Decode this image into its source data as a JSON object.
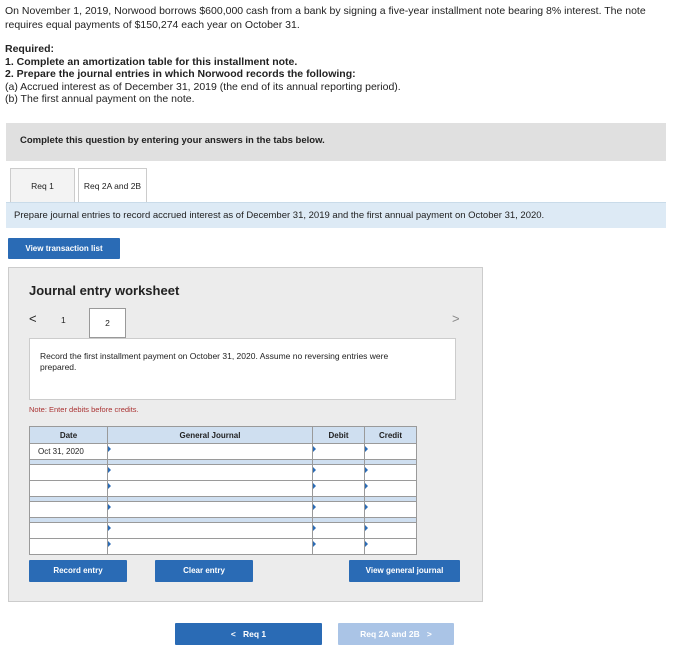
{
  "problem_text": "On November 1, 2019, Norwood borrows $600,000 cash from a bank by signing a five-year installment note bearing 8% interest. The note requires equal payments of $150,274 each year on October 31.",
  "required": {
    "heading": "Required:",
    "item1": "1. Complete an amortization table for this installment note.",
    "item2": "2. Prepare the journal entries in which Norwood records the following:",
    "item2a": "(a) Accrued interest as of December 31, 2019 (the end of its annual reporting period).",
    "item2b": "(b) The first annual payment on the note."
  },
  "banner_text": "Complete this question by entering your answers in the tabs below.",
  "tabs": [
    {
      "label": "Req 1"
    },
    {
      "label": "Req 2A and 2B"
    }
  ],
  "instruction": "Prepare journal entries to record accrued interest as of December 31, 2019 and the first annual payment on October 31, 2020.",
  "view_transaction_label": "View transaction list",
  "worksheet": {
    "title": "Journal entry worksheet",
    "prev_arrow": "<",
    "next_arrow": ">",
    "page1": "1",
    "page2": "2",
    "record_text": "Record the first installment payment on October 31, 2020. Assume no reversing entries were prepared.",
    "note": "Note: Enter debits before credits.",
    "columns": [
      "Date",
      "General Journal",
      "Debit",
      "Credit"
    ],
    "first_date": "Oct 31, 2020",
    "record_entry_label": "Record entry",
    "clear_entry_label": "Clear entry",
    "view_general_journal_label": "View general journal"
  },
  "footer": {
    "prev_label": "Req 1",
    "prev_arrow": "<",
    "next_label": "Req 2A and 2B",
    "next_arrow": ">"
  },
  "colors": {
    "primary_button": "#2a6bb5",
    "disabled_button": "#aac4e6",
    "header_blue": "#cfdff0",
    "instruction_bg": "#ddeaf5"
  }
}
